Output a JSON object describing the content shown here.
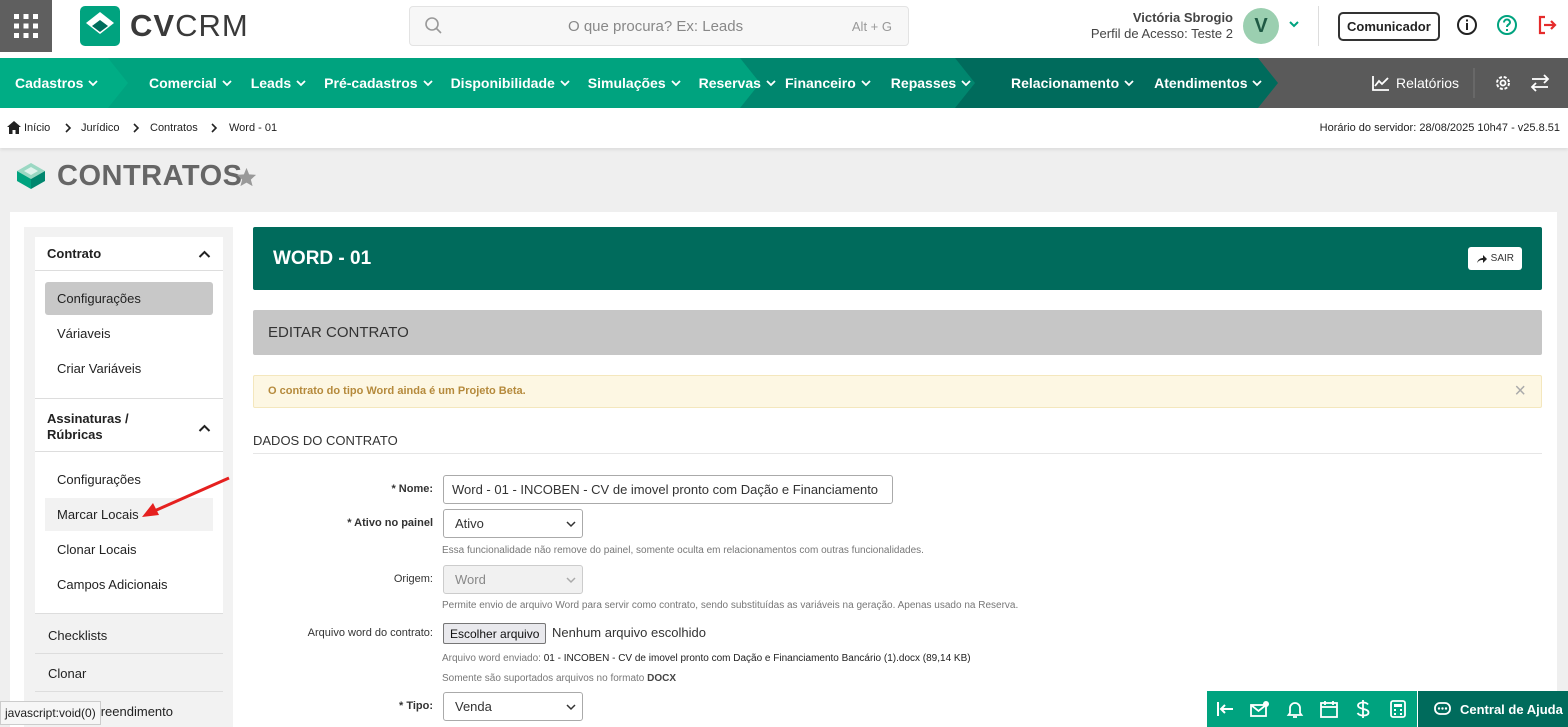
{
  "header": {
    "search_placeholder": "O que procura? Ex: Leads",
    "search_shortcut": "Alt + G",
    "user_name": "Victória Sbrogio",
    "user_profile": "Perfil de Acesso: Teste 2",
    "avatar_initial": "V",
    "communicator_label": "Comunicador",
    "logo_cv": "CV",
    "logo_crm": "CRM"
  },
  "nav": {
    "items": [
      {
        "label": "Cadastros"
      },
      {
        "label": "Comercial"
      },
      {
        "label": "Leads"
      },
      {
        "label": "Pré-cadastros"
      },
      {
        "label": "Disponibilidade"
      },
      {
        "label": "Simulações"
      },
      {
        "label": "Reservas"
      },
      {
        "label": "Financeiro"
      },
      {
        "label": "Repasses"
      },
      {
        "label": "Relacionamento"
      },
      {
        "label": "Atendimentos"
      }
    ],
    "reports_label": "Relatórios"
  },
  "breadcrumb": {
    "items": [
      "Início",
      "Jurídico",
      "Contratos",
      "Word - 01"
    ],
    "server_time": "Horário do servidor: 28/08/2025 10h47 - v25.8.51"
  },
  "page": {
    "title": "CONTRATOS"
  },
  "sidebar": {
    "contract_header": "Contrato",
    "contract_items": [
      "Configurações",
      "Váriaveis",
      "Criar Variáveis"
    ],
    "signatures_header": "Assinaturas / Rúbricas",
    "signature_items": [
      "Configurações",
      "Marcar Locais",
      "Clonar Locais",
      "Campos Adicionais"
    ],
    "other_items": [
      "Checklists",
      "Clonar",
      "Empreendimento"
    ]
  },
  "card": {
    "title": "WORD - 01",
    "exit_label": "SAIR",
    "edit_title": "EDITAR CONTRATO",
    "alert": "O contrato do tipo Word ainda é um Projeto Beta.",
    "alert_close": "×",
    "section_title": "DADOS DO CONTRATO"
  },
  "form": {
    "name_label": "* Nome:",
    "name_value": "Word - 01 - INCOBEN - CV de imovel pronto com Dação e Financiamento",
    "active_label": "* Ativo no painel",
    "active_value": "Ativo",
    "active_help": "Essa funcionalidade não remove do painel, somente oculta em relacionamentos com outras funcionalidades.",
    "origin_label": "Origem:",
    "origin_value": "Word",
    "origin_help": "Permite envio de arquivo Word para servir como contrato, sendo substituídas as variáveis na geração. Apenas usado na Reserva.",
    "file_label": "Arquivo word do contrato:",
    "file_button": "Escolher arquivo",
    "file_status": "Nenhum arquivo escolhido",
    "sent_prefix": "Arquivo word enviado:",
    "sent_file": "01 - INCOBEN - CV de imovel pronto com Dação e Financiamento Bancário (1).docx (89,14 KB)",
    "supported_prefix": "Somente são suportados arquivos no formato",
    "supported_format": "DOCX",
    "type_label": "* Tipo:",
    "type_value": "Venda"
  },
  "footer": {
    "status_url": "javascript:void(0)",
    "help_center": "Central de Ajuda"
  },
  "colors": {
    "primary": "#006b5c",
    "accent": "#00a37f",
    "nav_dark": "#5a5a5a",
    "danger": "#e52b2b"
  }
}
